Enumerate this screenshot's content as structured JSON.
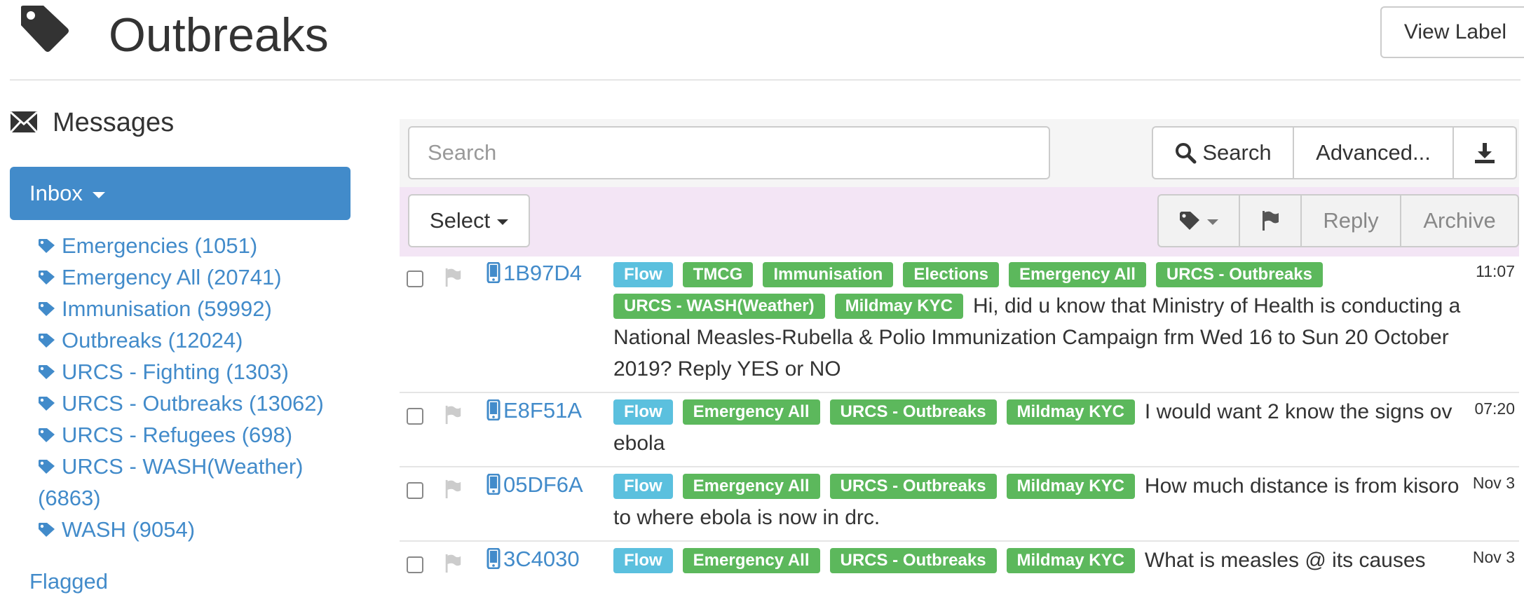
{
  "header": {
    "title": "Outbreaks",
    "view_label_button": "View Label"
  },
  "sidebar": {
    "heading": "Messages",
    "inbox_label": "Inbox",
    "labels": [
      "Emergencies (1051)",
      "Emergency All (20741)",
      "Immunisation (59992)",
      "Outbreaks (12024)",
      "URCS - Fighting (1303)",
      "URCS - Outbreaks (13062)",
      "URCS - Refugees (698)",
      "URCS - WASH(Weather) (6863)",
      "WASH (9054)"
    ],
    "flagged": "Flagged"
  },
  "search": {
    "placeholder": "Search",
    "search_button": "Search",
    "advanced_button": "Advanced..."
  },
  "actions": {
    "select_button": "Select",
    "reply_button": "Reply",
    "archive_button": "Archive"
  },
  "messages": [
    {
      "contact": "1B97D4",
      "time": "11:07",
      "tags": [
        "Flow",
        "TMCG",
        "Immunisation",
        "Elections",
        "Emergency All",
        "URCS - Outbreaks",
        "URCS - WASH(Weather)",
        "Mildmay KYC"
      ],
      "text": "Hi, did u know that Ministry of Health is conducting a National Measles-Rubella & Polio Immunization Campaign frm Wed 16 to Sun 20 October 2019? Reply YES or NO"
    },
    {
      "contact": "E8F51A",
      "time": "07:20",
      "tags": [
        "Flow",
        "Emergency All",
        "URCS - Outbreaks",
        "Mildmay KYC"
      ],
      "text": "I would want 2 know the signs ov ebola"
    },
    {
      "contact": "05DF6A",
      "time": "Nov 3",
      "tags": [
        "Flow",
        "Emergency All",
        "URCS - Outbreaks",
        "Mildmay KYC"
      ],
      "text": "How much distance is from kisoro to where ebola is now in drc."
    },
    {
      "contact": "3C4030",
      "time": "Nov 3",
      "tags": [
        "Flow",
        "Emergency All",
        "URCS - Outbreaks",
        "Mildmay KYC"
      ],
      "text": "What is measles @ its causes"
    }
  ],
  "colors": {
    "primary": "#428bca",
    "tag_flow": "#5bc0de",
    "tag_label": "#5cb85c",
    "action_bar": "#f3e5f5"
  },
  "icons": {
    "title": "tag-icon",
    "messages": "envelope-icon",
    "search": "search-icon",
    "download": "download-icon",
    "label": "tag-icon",
    "flag": "flag-icon",
    "contact": "phone-icon"
  }
}
